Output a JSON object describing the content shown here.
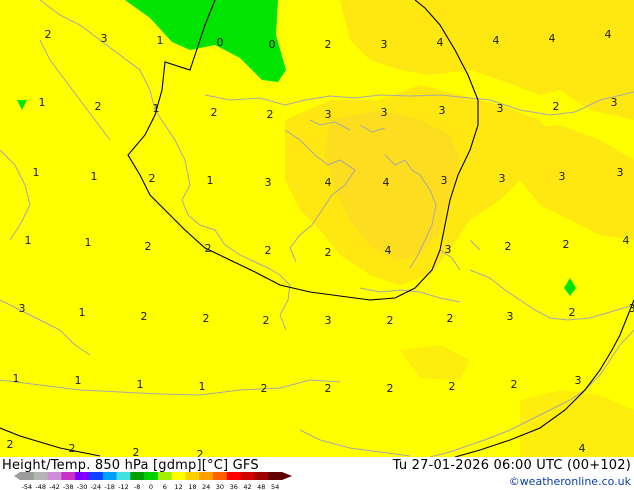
{
  "colors": {
    "base_yellow": "#ffff00",
    "mid_yellow": "#ffe812",
    "warm_yellow": "#fbd42a",
    "green": "#00e400",
    "coast": "#a8a8a8",
    "contour": "#000000"
  },
  "map": {
    "values": [
      {
        "t": "2"
      },
      {
        "t": "3"
      },
      {
        "t": "1"
      },
      {
        "t": "0"
      },
      {
        "t": "0"
      },
      {
        "t": "2"
      },
      {
        "t": "3"
      },
      {
        "t": "4"
      },
      {
        "t": "4"
      },
      {
        "t": "4"
      },
      {
        "t": "4"
      },
      {
        "t": "1"
      },
      {
        "t": "2"
      },
      {
        "t": "1"
      },
      {
        "t": "2"
      },
      {
        "t": "2"
      },
      {
        "t": "3"
      },
      {
        "t": "3"
      },
      {
        "t": "3"
      },
      {
        "t": "3"
      },
      {
        "t": "2"
      },
      {
        "t": "3"
      },
      {
        "t": "1"
      },
      {
        "t": "1"
      },
      {
        "t": "2"
      },
      {
        "t": "1"
      },
      {
        "t": "3"
      },
      {
        "t": "4"
      },
      {
        "t": "4"
      },
      {
        "t": "3"
      },
      {
        "t": "3"
      },
      {
        "t": "3"
      },
      {
        "t": "3"
      },
      {
        "t": "1"
      },
      {
        "t": "1"
      },
      {
        "t": "2"
      },
      {
        "t": "2"
      },
      {
        "t": "2"
      },
      {
        "t": "2"
      },
      {
        "t": "4"
      },
      {
        "t": "3"
      },
      {
        "t": "2"
      },
      {
        "t": "2"
      },
      {
        "t": "4"
      },
      {
        "t": "3"
      },
      {
        "t": "1"
      },
      {
        "t": "2"
      },
      {
        "t": "2"
      },
      {
        "t": "2"
      },
      {
        "t": "3"
      },
      {
        "t": "2"
      },
      {
        "t": "2"
      },
      {
        "t": "3"
      },
      {
        "t": "2"
      },
      {
        "t": "3"
      },
      {
        "t": "1"
      },
      {
        "t": "1"
      },
      {
        "t": "1"
      },
      {
        "t": "1"
      },
      {
        "t": "2"
      },
      {
        "t": "2"
      },
      {
        "t": "2"
      },
      {
        "t": "2"
      },
      {
        "t": "2"
      },
      {
        "t": "3"
      },
      {
        "t": "2"
      },
      {
        "t": "2"
      },
      {
        "t": "2"
      },
      {
        "t": "2"
      },
      {
        "t": "4"
      }
    ]
  },
  "footer": {
    "title": "Height/Temp. 850 hPa [gdmp][°C] GFS",
    "datetime": "Tu 27-01-2026 06:00 UTC (00+102)",
    "credit": "©weatheronline.co.uk"
  },
  "scale": {
    "labels": [
      "-54",
      "-48",
      "-42",
      "-38",
      "-30",
      "-24",
      "-18",
      "-12",
      "-8",
      "0",
      "6",
      "12",
      "18",
      "24",
      "30",
      "36",
      "42",
      "48",
      "54"
    ],
    "colors": [
      "#9c9c9c",
      "#b4b4b4",
      "#d08cd8",
      "#c830c8",
      "#8000ff",
      "#1040ff",
      "#00a0ff",
      "#40e0e0",
      "#00a000",
      "#00d000",
      "#a0f000",
      "#ffff00",
      "#ffd000",
      "#ffa000",
      "#ff6000",
      "#ff0000",
      "#d00000",
      "#a00000",
      "#600000"
    ]
  }
}
